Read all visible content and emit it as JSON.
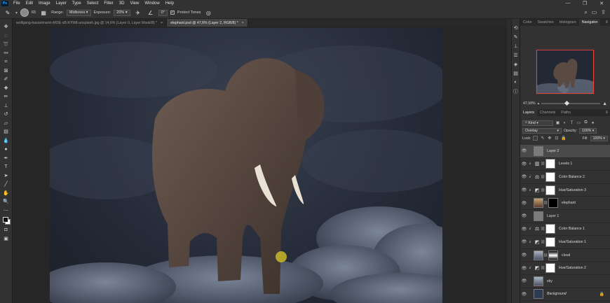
{
  "menubar": {
    "logo": "Ps",
    "items": [
      "File",
      "Edit",
      "Image",
      "Layer",
      "Type",
      "Select",
      "Filter",
      "3D",
      "View",
      "Window",
      "Help"
    ],
    "window_controls": [
      "—",
      "❐",
      "✕"
    ]
  },
  "options": {
    "brush_size": "65",
    "range_label": "Range:",
    "range_value": "Midtones",
    "exposure_label": "Exposure:",
    "exposure_value": "20%",
    "angle_value": "0°",
    "protect_tones_label": "Protect Tones",
    "protect_tones_checked": true
  },
  "tabs": [
    {
      "label": "wolfgang-hasselmann-MOE-sB-KYM8-unsplash.jpg @ 14,6% (Layer 0, Layer Mask/8) *",
      "active": false
    },
    {
      "label": "elephant.psd @ 47,6% (Layer 2, RGB/8) *",
      "active": true
    }
  ],
  "panels": {
    "top_tabs": [
      "Color",
      "Swatches",
      "Histogram",
      "Navigator"
    ],
    "active_top_tab": "Navigator",
    "zoom": "47,58%",
    "layer_tabs": [
      "Layers",
      "Channels",
      "Paths"
    ],
    "filter_kind": "Kind",
    "blend_mode": "Overlay",
    "opacity_label": "Opacity:",
    "opacity_value": "100%",
    "lock_label": "Lock:",
    "fill_label": "Fill:",
    "fill_value": "100%"
  },
  "layers": [
    {
      "name": "Layer 2",
      "type": "pixel",
      "thumb": "gray",
      "selected": true
    },
    {
      "name": "Levels 1",
      "type": "adjust",
      "icon": "levels",
      "mask": "white",
      "clip": true
    },
    {
      "name": "Color Balance 2",
      "type": "adjust",
      "icon": "balance",
      "mask": "white",
      "clip": true
    },
    {
      "name": "Hue/Saturation 3",
      "type": "adjust",
      "icon": "hue",
      "mask": "white",
      "clip": true
    },
    {
      "name": "elephant",
      "type": "pixel-mask",
      "thumb": "elephant",
      "mask": "black"
    },
    {
      "name": "Layer 1",
      "type": "pixel",
      "thumb": "gray"
    },
    {
      "name": "Color Balance 1",
      "type": "adjust",
      "icon": "balance",
      "mask": "white",
      "clip": true
    },
    {
      "name": "Hue/Saturation 1",
      "type": "adjust",
      "icon": "hue",
      "mask": "white",
      "clip": true
    },
    {
      "name": "cloud",
      "type": "pixel-mask",
      "thumb": "cloud",
      "mask": "cloudmask"
    },
    {
      "name": "Hue/Saturation 2",
      "type": "adjust",
      "icon": "hue",
      "mask": "white",
      "clip": true
    },
    {
      "name": "sky",
      "type": "pixel",
      "thumb": "cloud"
    },
    {
      "name": "Background",
      "type": "background",
      "thumb": "bg",
      "locked": true
    }
  ],
  "colors": {
    "accent_nav_frame": "#e8433b",
    "brush_cursor": "#c8b82a",
    "selected_layer": "#4a4a4a"
  }
}
